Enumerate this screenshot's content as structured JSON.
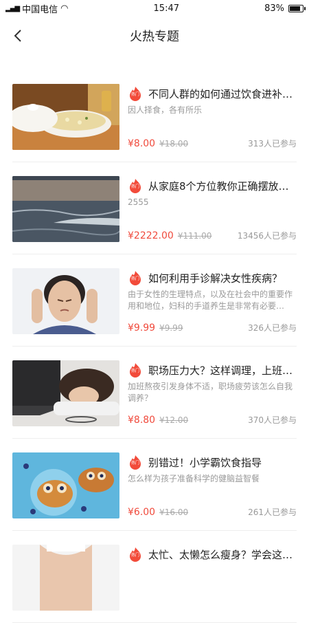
{
  "status": {
    "carrier": "中国电信",
    "signal_label": "4G",
    "time": "15:47",
    "battery": "83%",
    "battery_level": 0.83
  },
  "header": {
    "title": "火热专题"
  },
  "hot_label": "热门",
  "items": [
    {
      "title": "不同人群的如何通过饮食进补…",
      "desc": "因人择食，各有所乐",
      "price": "¥8.00",
      "orig_price": "¥18.00",
      "participants": "313人已参与",
      "image": "soup-bowl"
    },
    {
      "title": "从家庭8个方位教你正确摆放…",
      "desc": "2555",
      "price": "¥2222.00",
      "orig_price": "¥111.00",
      "participants": "13456人已参与",
      "image": "sea-waves"
    },
    {
      "title": "如何利用手诊解决女性疾病？",
      "desc": "由于女性的生理特点，以及在社会中的重要作用和地位，妇科的手道养生是非常有必要…",
      "price": "¥9.99",
      "orig_price": "¥9.99",
      "participants": "326人已参与",
      "image": "woman-headache"
    },
    {
      "title": "职场压力大？这样调理，上班…",
      "desc": "加班熬夜引发身体不适，职场疲劳该怎么自我调养？",
      "price": "¥8.80",
      "orig_price": "¥12.00",
      "participants": "370人已参与",
      "image": "tired-worker"
    },
    {
      "title": "别错过！小学霸饮食指导",
      "desc": "怎么样为孩子准备科学的健脑益智餐",
      "price": "¥6.00",
      "orig_price": "¥16.00",
      "participants": "261人已参与",
      "image": "owl-pancakes"
    },
    {
      "title": "太忙、太懒怎么瘦身？学会这…",
      "desc": "",
      "price": "",
      "orig_price": "",
      "participants": "",
      "image": "fitness-body"
    }
  ]
}
